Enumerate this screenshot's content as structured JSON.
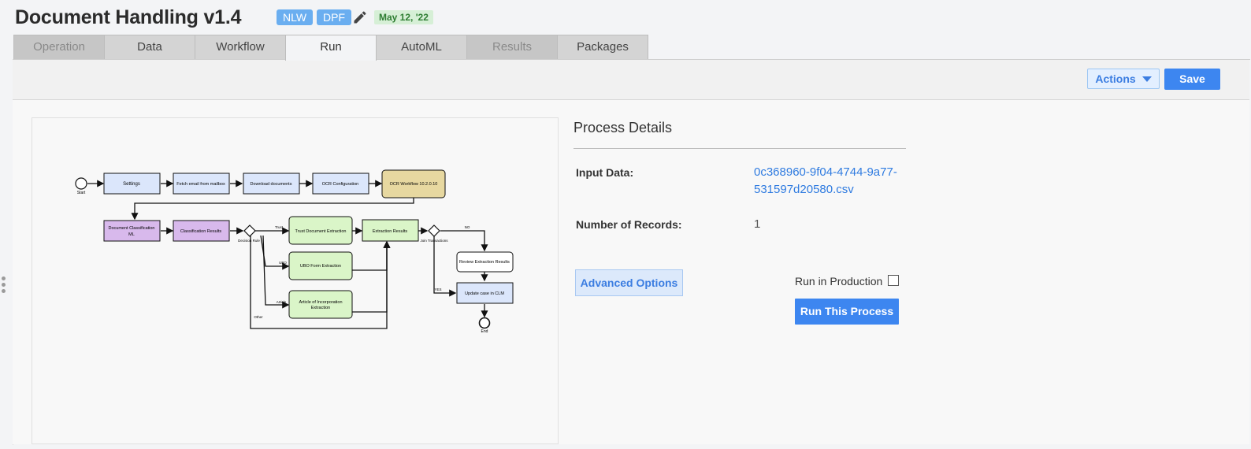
{
  "header": {
    "title": "Document Handling v1.4",
    "tags": [
      "NLW",
      "DPF"
    ],
    "date": "May 12, '22"
  },
  "tabs": [
    {
      "label": "Operation",
      "state": "disabled"
    },
    {
      "label": "Data",
      "state": "normal"
    },
    {
      "label": "Workflow",
      "state": "normal"
    },
    {
      "label": "Run",
      "state": "active"
    },
    {
      "label": "AutoML",
      "state": "normal"
    },
    {
      "label": "Results",
      "state": "disabled"
    },
    {
      "label": "Packages",
      "state": "normal"
    }
  ],
  "toolbar": {
    "actions_label": "Actions",
    "save_label": "Save"
  },
  "diagram": {
    "start_label": "Start",
    "end_label": "End",
    "nodes": {
      "settings": "Settings",
      "fetch": "Fetch email from mailbox",
      "download": "Download documents",
      "ocr_config": "OCR Configuration",
      "ocr_workflow": "OCR Workflow 10.2.0.10",
      "doc_class_1": "Document Classification",
      "doc_class_2": "ML",
      "class_results": "Classification Results",
      "decision": "Decision Rule",
      "trust": "Trust Document Extraction",
      "ubo": "UBO Form Extraction",
      "article_1": "Article of Incorporation",
      "article_2": "Extraction",
      "extraction_results": "Extraction Results",
      "join": "Join Transactions",
      "review": "Review Extraction Results",
      "update": "Update case in CLM"
    },
    "edge_labels": {
      "trust": "Trust",
      "ubo": "UBO",
      "article": "Article",
      "other": "Other",
      "no": "NO",
      "yes": "YES"
    }
  },
  "process_details": {
    "title": "Process Details",
    "input_label": "Input Data:",
    "input_value_line1": "0c368960-9f04-4744-9a77-",
    "input_value_line2": "531597d20580.csv",
    "records_label": "Number of Records:",
    "records_value": "1",
    "advanced_label": "Advanced Options",
    "run_in_production_label": "Run in Production",
    "run_label": "Run This Process"
  },
  "colors": {
    "accent": "#3d86f0",
    "link": "#2f7be0",
    "blue_node": "#dbe6fb",
    "purple_node": "#d8b9ec",
    "green_node": "#daf5c8",
    "tan_node": "#e7d8a0"
  }
}
